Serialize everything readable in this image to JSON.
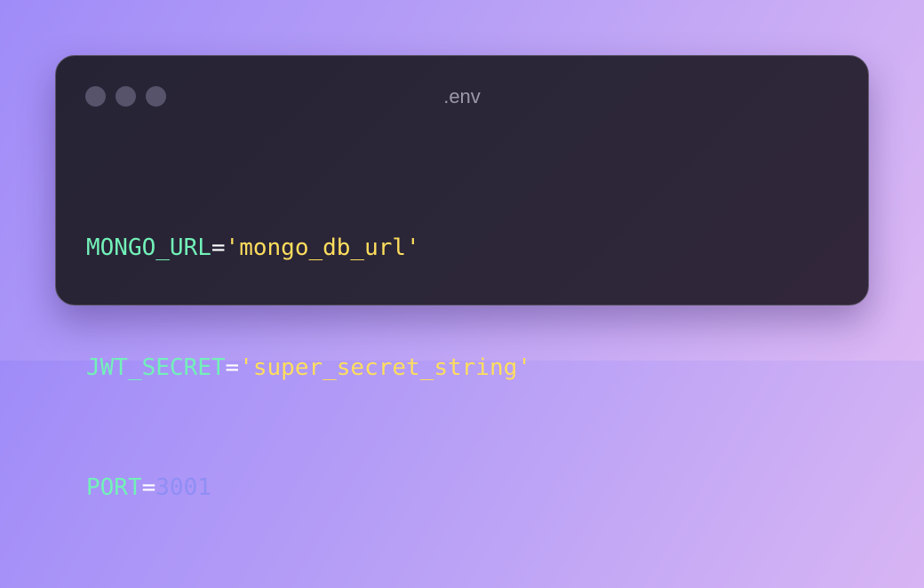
{
  "window": {
    "title": ".env",
    "controls": [
      {
        "name": "close",
        "color": "#57536a"
      },
      {
        "name": "minimize",
        "color": "#57536a"
      },
      {
        "name": "maximize",
        "color": "#57536a"
      }
    ]
  },
  "colors": {
    "key": "#72f1b8",
    "operator": "#ffffff",
    "string": "#fede5d",
    "number": "#8f8ef5"
  },
  "code": {
    "lines": [
      {
        "key": "MONGO_URL",
        "op": "=",
        "value": "'mongo_db_url'",
        "value_type": "string"
      },
      {
        "key": "JWT_SECRET",
        "op": "=",
        "value": "'super_secret_string'",
        "value_type": "string"
      },
      {
        "key": "PORT",
        "op": "=",
        "value": "3001",
        "value_type": "number"
      }
    ]
  }
}
